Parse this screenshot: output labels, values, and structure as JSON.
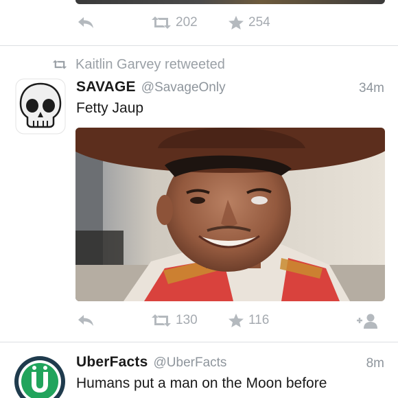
{
  "previous_tweet": {
    "retweet_count": "202",
    "favorite_count": "254"
  },
  "tweet1": {
    "retweeted_by": "Kaitlin Garvey retweeted",
    "name": "SAVAGE",
    "handle": "@SavageOnly",
    "time": "34m",
    "text": "Fetty Jaup",
    "avatar_icon": "skull-emoji",
    "retweet_count": "130",
    "favorite_count": "116"
  },
  "tweet2": {
    "name": "UberFacts",
    "handle": "@UberFacts",
    "time": "8m",
    "text": "Humans put a man on the Moon before",
    "avatar_letter": "Ü"
  },
  "colors": {
    "icon_gray": "#a5aab0",
    "uber_green": "#21a45c",
    "uber_dark": "#1f3b4d"
  }
}
